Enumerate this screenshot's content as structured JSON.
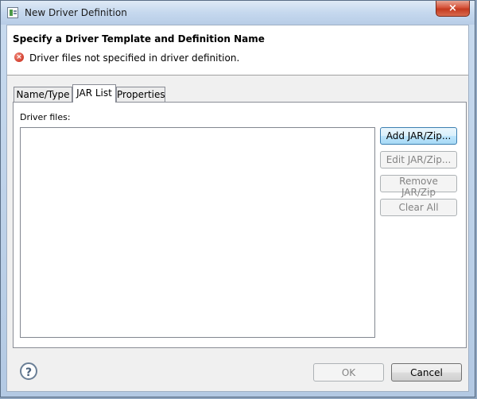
{
  "window": {
    "title": "New Driver Definition",
    "close_glyph": "×"
  },
  "header": {
    "title": "Specify a Driver Template and Definition Name",
    "error_glyph": "×",
    "error_message": "Driver files not specified in driver definition."
  },
  "tabs": [
    {
      "label": "Name/Type",
      "selected": false
    },
    {
      "label": "JAR List",
      "selected": true
    },
    {
      "label": "Properties",
      "selected": false
    }
  ],
  "jar_list": {
    "label": "Driver files:",
    "items": []
  },
  "side_buttons": {
    "add": "Add JAR/Zip...",
    "edit": "Edit JAR/Zip...",
    "remove": "Remove JAR/Zip",
    "clear": "Clear All"
  },
  "footer": {
    "help_glyph": "?",
    "ok": "OK",
    "cancel": "Cancel"
  },
  "colors": {
    "error": "#c4200e",
    "primary_button_border": "#3c7fb1"
  },
  "icons": {
    "app": "driver-definition-icon",
    "error": "error-icon",
    "help": "help-icon",
    "close": "close-icon"
  }
}
